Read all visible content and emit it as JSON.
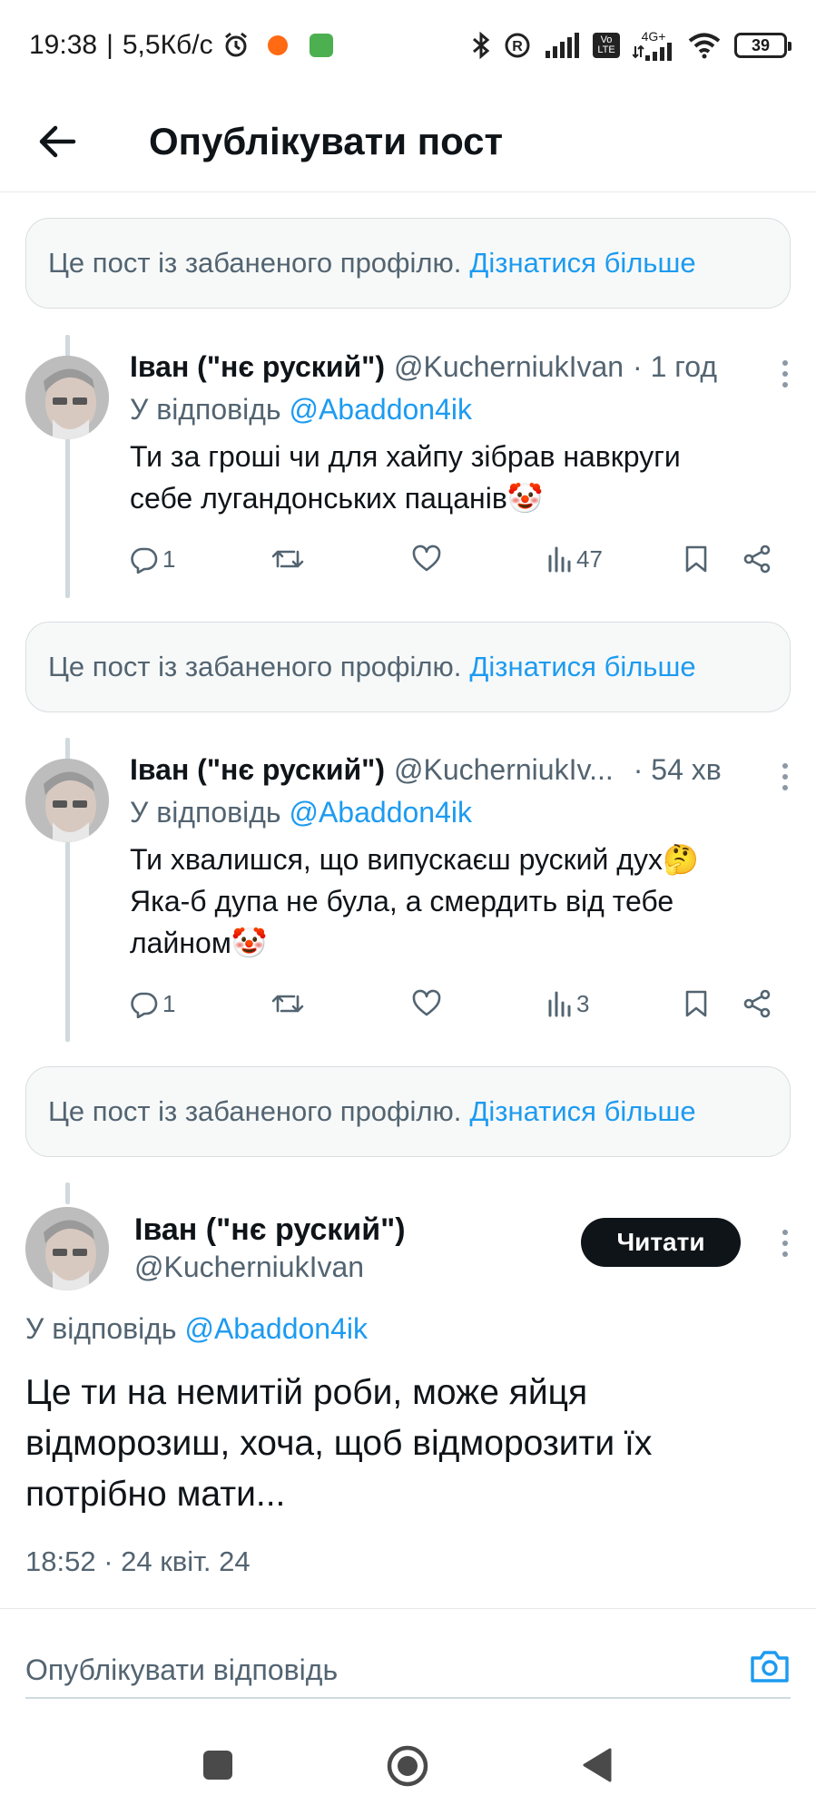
{
  "status_bar": {
    "time": "19:38",
    "speed": "5,5Кб/с",
    "battery": "39",
    "network": "4G+",
    "volte": "Vo LTE"
  },
  "header": {
    "title": "Опублікувати пост"
  },
  "notice": {
    "text": "Це пост із забаненого профілю.",
    "link": "Дізнатися більше"
  },
  "posts": [
    {
      "name": "Іван (\"нє руский\")",
      "handle": "@KucherniukIvan",
      "time": "· 1 год",
      "reply_prefix": "У відповідь",
      "reply_to": "@Abaddon4ik",
      "text": "Ти за гроші чи для хайпу зібрав навкруги себе лугандонських пацанів🤡",
      "replies": "1",
      "views": "47"
    },
    {
      "name": "Іван (\"нє руский\")",
      "handle": "@KucherniukIv...",
      "time": "· 54 хв",
      "reply_prefix": "У відповідь",
      "reply_to": "@Abaddon4ik",
      "text": "Ти хвалишся, що випускаєш руский дух🤔 Яка-б дупа не була, а смердить від тебе лайном🤡",
      "replies": "1",
      "views": "3"
    }
  ],
  "main_post": {
    "name": "Іван (\"нє руский\")",
    "handle": "@KucherniukIvan",
    "follow_label": "Читати",
    "reply_prefix": "У відповідь",
    "reply_to": "@Abaddon4ik",
    "text": "Це ти на немитій роби, може яйця відморозиш, хоча, щоб відморозити їх потрібно мати...",
    "timestamp": "18:52 · 24 квіт. 24"
  },
  "composer": {
    "placeholder": "Опублікувати відповідь"
  },
  "colors": {
    "accent": "#1d9bf0",
    "text_primary": "#0f1419",
    "text_secondary": "#536471",
    "border": "#e6e9eb"
  },
  "icons": [
    "back-arrow-icon",
    "reply-icon",
    "retweet-icon",
    "like-icon",
    "views-icon",
    "bookmark-icon",
    "share-icon",
    "more-icon",
    "camera-icon",
    "nav-recents-icon",
    "nav-home-icon",
    "nav-back-icon"
  ]
}
